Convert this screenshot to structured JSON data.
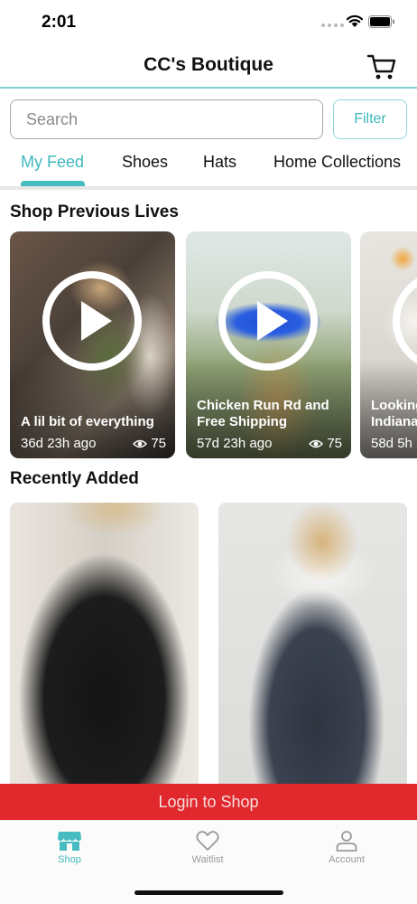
{
  "status": {
    "time": "2:01"
  },
  "header": {
    "title": "CC's Boutique",
    "cart_icon": "cart-icon"
  },
  "search": {
    "placeholder": "Search",
    "value": "",
    "filter_label": "Filter"
  },
  "tabs": [
    {
      "label": "My Feed",
      "active": true
    },
    {
      "label": "Shoes",
      "active": false
    },
    {
      "label": "Hats",
      "active": false
    },
    {
      "label": "Home Collections",
      "active": false
    }
  ],
  "sections": {
    "lives_title": "Shop Previous Lives",
    "recent_title": "Recently Added"
  },
  "lives": [
    {
      "title": "A lil bit of everything",
      "age": "36d 23h ago",
      "views": "75"
    },
    {
      "title": "Chicken Run Rd and Free Shipping",
      "age": "57d 23h ago",
      "views": "75"
    },
    {
      "title": "Looking Indiana",
      "age": "58d 5h",
      "views": ""
    }
  ],
  "login_banner": "Login to Shop",
  "bottom_nav": [
    {
      "label": "Shop",
      "icon": "store-icon",
      "active": true
    },
    {
      "label": "Waitlist",
      "icon": "heart-icon",
      "active": false
    },
    {
      "label": "Account",
      "icon": "user-icon",
      "active": false
    }
  ],
  "colors": {
    "accent": "#3fb8bc",
    "banner": "#e1282d",
    "header_rule": "#7fcfd1"
  }
}
